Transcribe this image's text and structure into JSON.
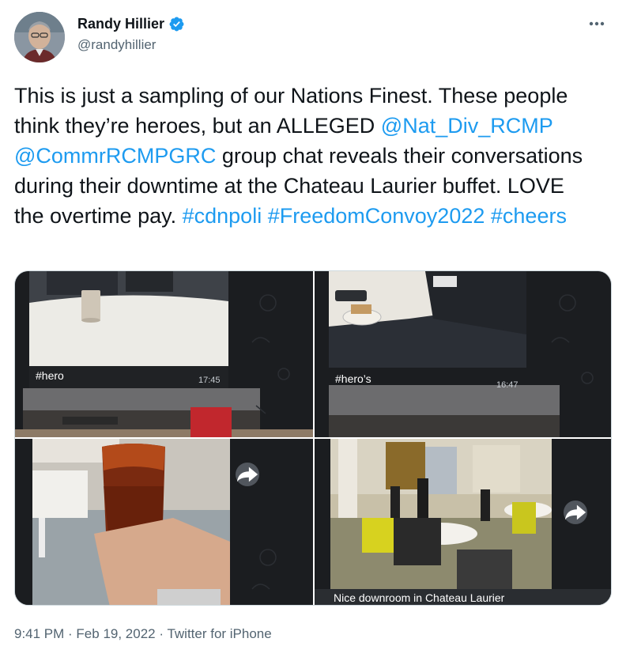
{
  "author": {
    "name": "Randy Hillier",
    "handle": "@randyhillier",
    "verified_icon": "verified-badge-icon",
    "avatar_icon": "profile-photo"
  },
  "tweet": {
    "text_part1": "This is just a sampling of our Nations Finest. These people think they’re heroes, but an ALLEGED ",
    "mention1": "@Nat_Div_RCMP",
    "mention2": "@CommrRCMPGRC",
    "text_part2": " group chat reveals their conversations during their downtime at the Chateau Laurier buffet. LOVE the overtime pay. ",
    "hashtag1": "#cdnpoli",
    "hashtag2": "#FreedomConvoy2022",
    "hashtag3": "#cheers"
  },
  "media": {
    "image1": {
      "caption": "#hero",
      "time": "17:45"
    },
    "image2": {
      "caption": "#hero’s",
      "time": "16:47"
    },
    "image3": {
      "forward_icon": "share-arrow-icon"
    },
    "image4": {
      "caption": "Nice downroom in Chateau Laurier",
      "forward_icon": "share-arrow-icon"
    }
  },
  "footer": {
    "time": "9:41 PM",
    "sep1": " · ",
    "date": "Feb 19, 2022",
    "sep2": " · ",
    "source": "Twitter for iPhone"
  },
  "colors": {
    "link": "#1d9bf0",
    "secondary_text": "#536471",
    "primary_text": "#0f1419"
  }
}
